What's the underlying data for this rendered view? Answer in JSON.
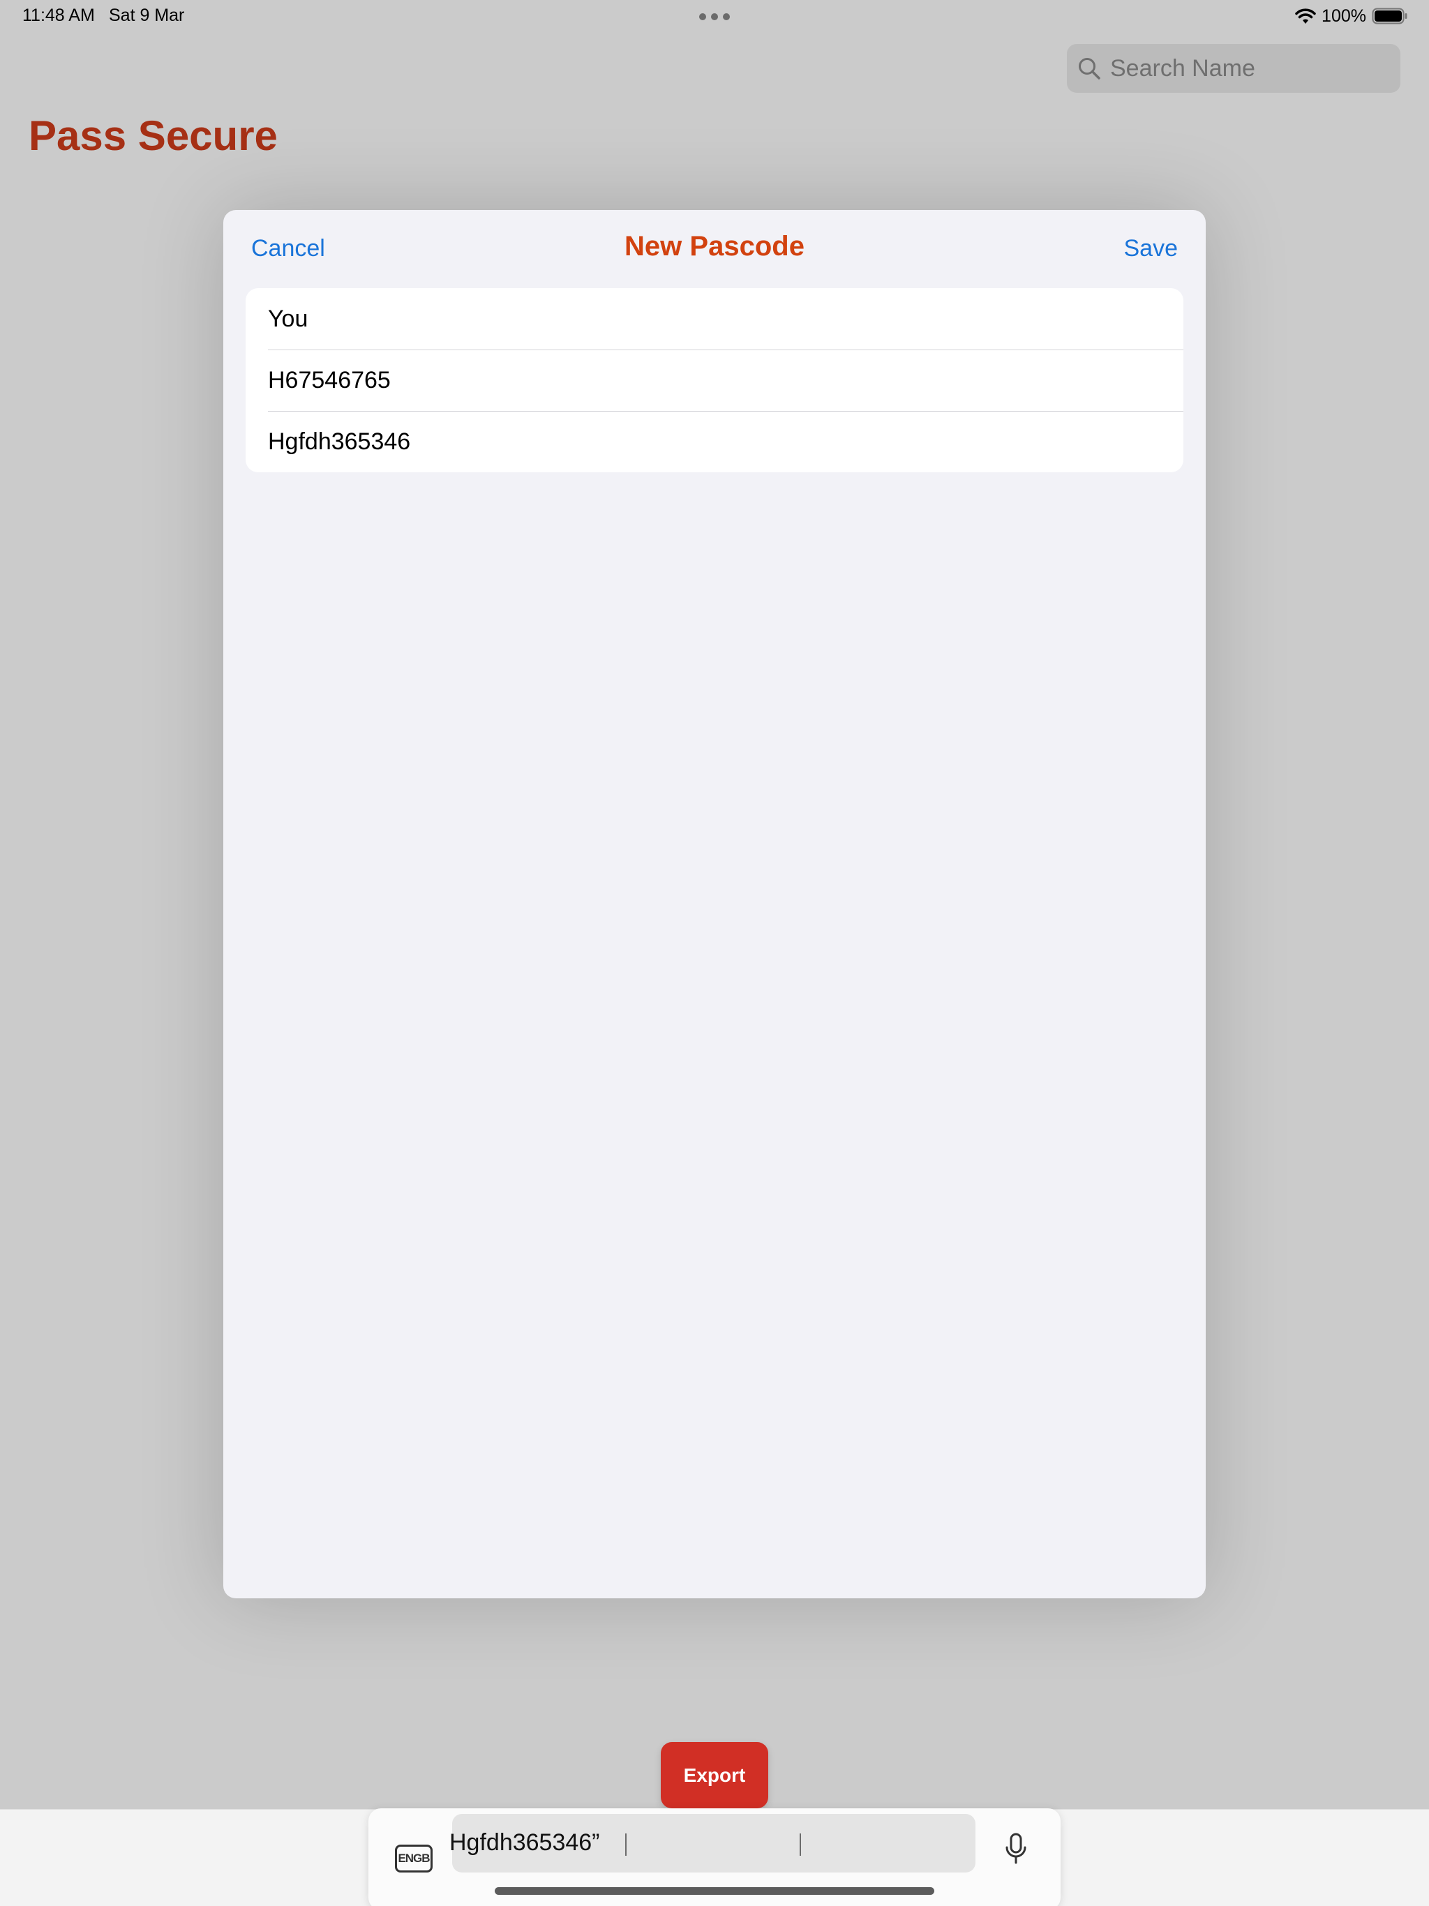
{
  "status_bar": {
    "time": "11:48 AM",
    "date": "Sat 9 Mar",
    "battery": "100%",
    "icons": [
      "wifi-icon",
      "battery-icon",
      "more-dots-icon"
    ]
  },
  "search": {
    "placeholder": "Search Name",
    "icon": "search-icon"
  },
  "app": {
    "title": "Pass Secure",
    "title_color": "#a63015"
  },
  "modal": {
    "cancel_label": "Cancel",
    "title": "New Pascode",
    "save_label": "Save",
    "fields": [
      {
        "value": "You"
      },
      {
        "value": "H67546765"
      },
      {
        "value": "Hgfdh365346"
      }
    ]
  },
  "export_label": "Export",
  "keyboard_shortcut_bar": {
    "language": "ENGB",
    "suggestion": "Hgfdh365346”",
    "icons": [
      "language-icon",
      "microphone-icon"
    ]
  },
  "colors": {
    "accent_blue": "#1a74d9",
    "modal_title": "#d2420f",
    "export_red": "#d12f25"
  }
}
